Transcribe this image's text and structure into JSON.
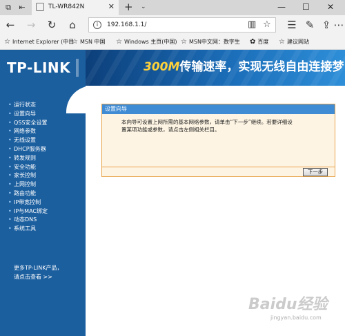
{
  "browser": {
    "tab_title": "TL-WR842N",
    "address": "192.168.1.1/",
    "tabbar_icons": [
      "set-aside-tabs-icon",
      "show-tabs-icon"
    ],
    "favorites": [
      {
        "label": "Internet Explorer (中目",
        "icon": "star-icon"
      },
      {
        "label": "MSN 中国",
        "icon": "star-icon"
      },
      {
        "label": "Windows 主页(中国)",
        "icon": "star-icon"
      },
      {
        "label": "MSN中文网：数字生",
        "icon": "star-icon"
      },
      {
        "label": "百度",
        "icon": "paw-icon"
      },
      {
        "label": "建议网站",
        "icon": "star-icon"
      }
    ]
  },
  "banner": {
    "logo": "TP-LINK",
    "slogan_highlight": "300M",
    "slogan_rest": "传输速率，实现无线自由连接梦"
  },
  "sidebar": {
    "items": [
      "运行状态",
      "设置向导",
      "QSS安全设置",
      "网络参数",
      "无线设置",
      "DHCP服务器",
      "转发规则",
      "安全功能",
      "家长控制",
      "上网控制",
      "路由功能",
      "IP带宽控制",
      "IP与MAC绑定",
      "动态DNS",
      "系统工具"
    ],
    "more_line1": "更多TP-LINK产品，",
    "more_line2": "请点击查看 >>"
  },
  "wizard": {
    "title": "设置向导",
    "description_line1": "本向导可设置上网所需的基本网络参数，请单击“下一步”继续。若要详细设",
    "description_line2": "置某项功能或参数，请点击左侧相关栏目。",
    "next_label": "下一步"
  },
  "watermark": {
    "text": "Baidu经验",
    "sub": "jingyan.baidu.com"
  },
  "colors": {
    "brand_blue": "#1c5f9f",
    "panel_header": "#3f8bd4",
    "panel_border": "#e8a34a",
    "panel_bg": "#fdf4e3",
    "slogan_highlight": "#ffd23a"
  }
}
